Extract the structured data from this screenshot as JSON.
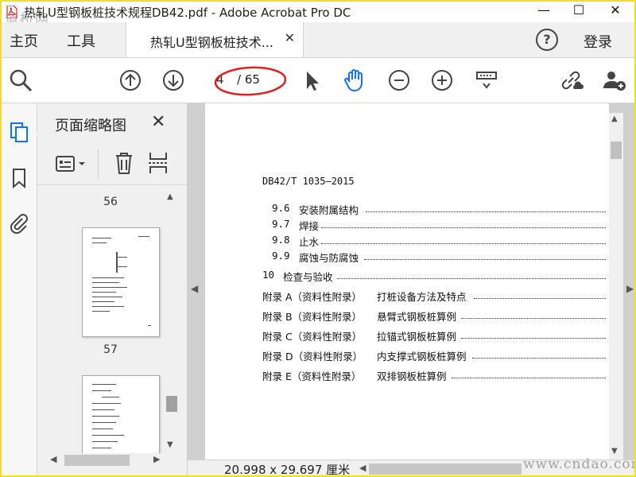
{
  "window": {
    "title": "热轧U型钢板桩技术规程DB42.pdf - Adobe Acrobat Pro DC",
    "watermark_tl": "道桥网",
    "minimize": "—",
    "maximize": "☐",
    "close": "✕"
  },
  "tabs": {
    "home": "主页",
    "tools": "工具",
    "doc_tab_label": "热轧U型钢板桩技术...",
    "doc_tab_close": "✕",
    "help": "?",
    "login": "登录"
  },
  "toolbar": {
    "page_current": "4",
    "page_total": "/ 65",
    "annotation_color": "#e0201c",
    "hand_color": "#1473e6"
  },
  "left_rail": {
    "icons": [
      "pages-icon",
      "bookmark-icon",
      "attachment-icon"
    ],
    "active_color": "#1473e6"
  },
  "thumb_panel": {
    "title": "页面缩略图",
    "close": "✕",
    "pages": [
      "56",
      "57"
    ]
  },
  "document": {
    "header": "DB42/T 1035—2015",
    "toc": [
      {
        "num": "9.6",
        "text": "安装附属结构"
      },
      {
        "num": "9.7",
        "text": "焊接"
      },
      {
        "num": "9.8",
        "text": "止水"
      },
      {
        "num": "9.9",
        "text": "腐蚀与防腐蚀"
      },
      {
        "num": "10",
        "text": "检查与验收"
      },
      {
        "num": "附录 A（资料性附录）",
        "text": "打桩设备方法及特点"
      },
      {
        "num": "附录 B（资料性附录）",
        "text": "悬臂式钢板桩算例"
      },
      {
        "num": "附录 C（资料性附录）",
        "text": "拉锚式钢板桩算例"
      },
      {
        "num": "附录 D（资料性附录）",
        "text": "内支撑式钢板桩算例"
      },
      {
        "num": "附录 E（资料性附录）",
        "text": "双排钢板桩算例"
      }
    ]
  },
  "status": {
    "page_size": "20.998 x 29.697 厘米",
    "watermark_br": "www.cndao.com"
  }
}
